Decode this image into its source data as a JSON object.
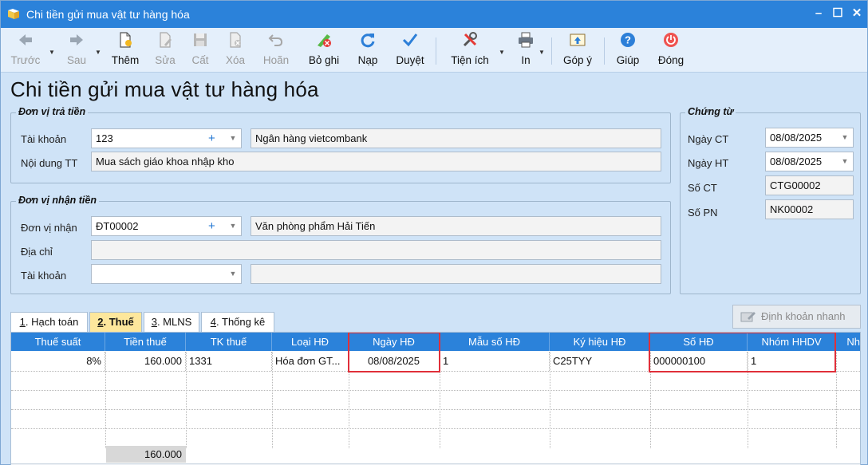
{
  "window": {
    "title": "Chi tiền gửi mua vật tư hàng hóa",
    "controls": [
      "–",
      "☐",
      "✕"
    ]
  },
  "toolbar": {
    "buttons": [
      {
        "label": "Trước",
        "icon": "arrow-left-icon",
        "enabled": false
      },
      {
        "label": "Sau",
        "icon": "arrow-right-icon",
        "enabled": false
      },
      {
        "label": "Thêm",
        "icon": "new-doc-icon",
        "enabled": true
      },
      {
        "label": "Sửa",
        "icon": "edit-doc-icon",
        "enabled": false
      },
      {
        "label": "Cất",
        "icon": "save-icon",
        "enabled": false
      },
      {
        "label": "Xóa",
        "icon": "delete-doc-icon",
        "enabled": false
      },
      {
        "label": "Hoãn",
        "icon": "undo-icon",
        "enabled": false
      },
      {
        "label": "Bỏ ghi",
        "icon": "unpost-icon",
        "enabled": true
      },
      {
        "label": "Nạp",
        "icon": "refresh-icon",
        "enabled": true
      },
      {
        "label": "Duyệt",
        "icon": "check-icon",
        "enabled": true
      },
      {
        "label": "Tiện ích",
        "icon": "tools-icon",
        "enabled": true
      },
      {
        "label": "In",
        "icon": "printer-icon",
        "enabled": true
      },
      {
        "label": "Góp ý",
        "icon": "feedback-icon",
        "enabled": true
      },
      {
        "label": "Giúp",
        "icon": "help-icon",
        "enabled": true
      },
      {
        "label": "Đóng",
        "icon": "power-icon",
        "enabled": true
      }
    ]
  },
  "form": {
    "title": "Chi tiền gửi mua vật tư hàng hóa",
    "payer": {
      "group_title": "Đơn vị trả tiền",
      "account_label": "Tài khoản",
      "account_value": "123",
      "account_plus": "+",
      "bank_name": "Ngân hàng vietcombank",
      "content_label": "Nội dung TT",
      "content_value": "Mua sách giáo khoa nhập kho"
    },
    "payee": {
      "group_title": "Đơn vị nhận tiền",
      "unit_label": "Đơn vị nhận",
      "unit_value": "ĐT00002",
      "unit_plus": "+",
      "unit_name": "Văn phòng phẩm Hải Tiến",
      "address_label": "Địa chỉ",
      "address_value": "",
      "account_label": "Tài khoản",
      "account_value": "",
      "account_name": ""
    },
    "voucher": {
      "group_title": "Chứng từ",
      "date_ct_label": "Ngày CT",
      "date_ct_value": "08/08/2025",
      "date_ht_label": "Ngày HT",
      "date_ht_value": "08/08/2025",
      "so_ct_label": "Số CT",
      "so_ct_value": "CTG00002",
      "so_pn_label": "Số PN",
      "so_pn_value": "NK00002"
    }
  },
  "tabs": [
    {
      "key": "1",
      "label": ". Hạch toán",
      "active": false
    },
    {
      "key": "2",
      "label": ". Thuế",
      "active": true
    },
    {
      "key": "3",
      "label": ". MLNS",
      "active": false
    },
    {
      "key": "4",
      "label": ". Thống kê",
      "active": false
    }
  ],
  "quick_entry_label": "Định khoản nhanh",
  "grid": {
    "columns": [
      "Thuế suất",
      "Tiền thuế",
      "TK thuế",
      "Loại HĐ",
      "Ngày HĐ",
      "Mẫu số HĐ",
      "Ký hiệu HĐ",
      "Số HĐ",
      "Nhóm HHDV",
      "Nh"
    ],
    "rows": [
      [
        "8%",
        "160.000",
        "1331",
        "Hóa đơn GT...",
        "08/08/2025",
        "1",
        "C25TYY",
        "000000100",
        "1",
        ""
      ]
    ],
    "total_tax": "160.000"
  },
  "colors": {
    "title_bar": "#2b82da",
    "background": "#cfe3f7",
    "active_tab": "#fde79c",
    "highlight": "#e0303a"
  }
}
